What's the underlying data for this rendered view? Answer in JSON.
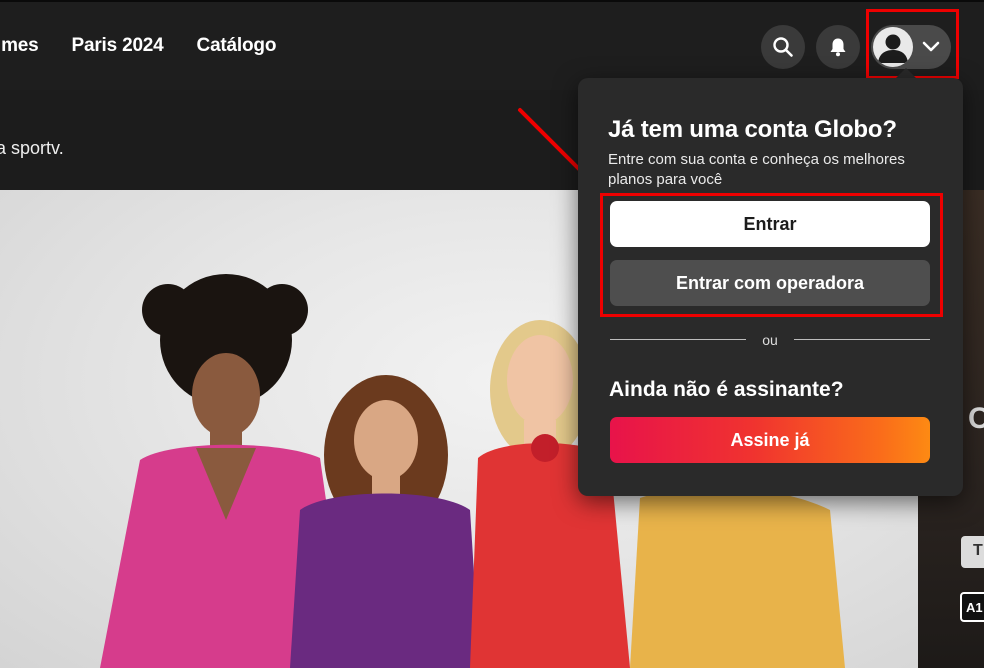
{
  "nav": {
    "links": [
      "lmes",
      "Paris 2024",
      "Catálogo"
    ]
  },
  "icons": {
    "search": "search-icon",
    "notifications": "bell-icon",
    "profile": "user-avatar-icon",
    "chevron": "chevron-down-icon"
  },
  "subbar": {
    "text": "a sportv."
  },
  "side": {
    "letter": "C",
    "tag": "T",
    "rating": "A1"
  },
  "dropdown": {
    "title": "Já tem uma conta Globo?",
    "description": "Entre com sua conta e conheça os melhores planos para você",
    "login_label": "Entrar",
    "operator_label": "Entrar com operadora",
    "divider": "ou",
    "subscribe_title": "Ainda não é assinante?",
    "subscribe_label": "Assine já"
  },
  "colors": {
    "highlight": "#e00000",
    "subscribe_gradient_start": "#e8134a",
    "subscribe_gradient_end": "#fd8a13",
    "background": "#1c1c1c",
    "menu": "#2a2a2a"
  }
}
